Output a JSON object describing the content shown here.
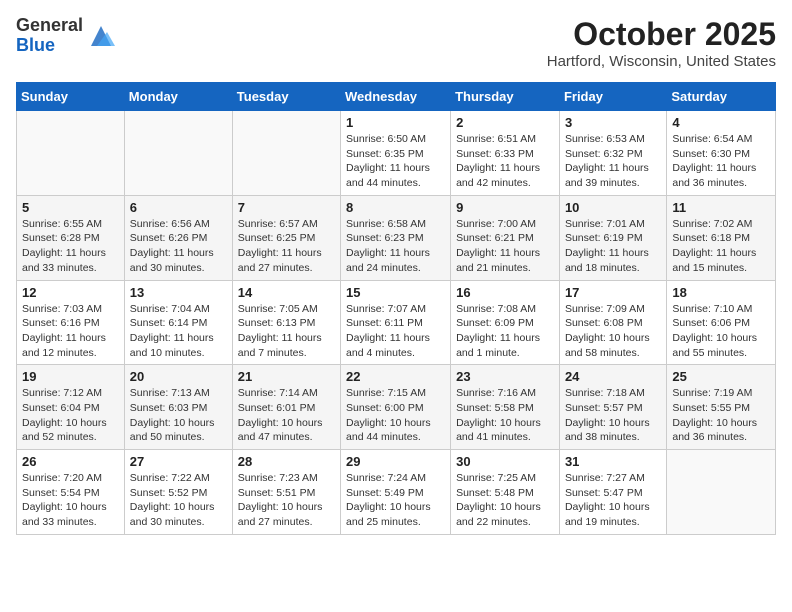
{
  "header": {
    "logo_general": "General",
    "logo_blue": "Blue",
    "month_title": "October 2025",
    "location": "Hartford, Wisconsin, United States"
  },
  "weekdays": [
    "Sunday",
    "Monday",
    "Tuesday",
    "Wednesday",
    "Thursday",
    "Friday",
    "Saturday"
  ],
  "weeks": [
    [
      {
        "day": "",
        "info": ""
      },
      {
        "day": "",
        "info": ""
      },
      {
        "day": "",
        "info": ""
      },
      {
        "day": "1",
        "info": "Sunrise: 6:50 AM\nSunset: 6:35 PM\nDaylight: 11 hours\nand 44 minutes."
      },
      {
        "day": "2",
        "info": "Sunrise: 6:51 AM\nSunset: 6:33 PM\nDaylight: 11 hours\nand 42 minutes."
      },
      {
        "day": "3",
        "info": "Sunrise: 6:53 AM\nSunset: 6:32 PM\nDaylight: 11 hours\nand 39 minutes."
      },
      {
        "day": "4",
        "info": "Sunrise: 6:54 AM\nSunset: 6:30 PM\nDaylight: 11 hours\nand 36 minutes."
      }
    ],
    [
      {
        "day": "5",
        "info": "Sunrise: 6:55 AM\nSunset: 6:28 PM\nDaylight: 11 hours\nand 33 minutes."
      },
      {
        "day": "6",
        "info": "Sunrise: 6:56 AM\nSunset: 6:26 PM\nDaylight: 11 hours\nand 30 minutes."
      },
      {
        "day": "7",
        "info": "Sunrise: 6:57 AM\nSunset: 6:25 PM\nDaylight: 11 hours\nand 27 minutes."
      },
      {
        "day": "8",
        "info": "Sunrise: 6:58 AM\nSunset: 6:23 PM\nDaylight: 11 hours\nand 24 minutes."
      },
      {
        "day": "9",
        "info": "Sunrise: 7:00 AM\nSunset: 6:21 PM\nDaylight: 11 hours\nand 21 minutes."
      },
      {
        "day": "10",
        "info": "Sunrise: 7:01 AM\nSunset: 6:19 PM\nDaylight: 11 hours\nand 18 minutes."
      },
      {
        "day": "11",
        "info": "Sunrise: 7:02 AM\nSunset: 6:18 PM\nDaylight: 11 hours\nand 15 minutes."
      }
    ],
    [
      {
        "day": "12",
        "info": "Sunrise: 7:03 AM\nSunset: 6:16 PM\nDaylight: 11 hours\nand 12 minutes."
      },
      {
        "day": "13",
        "info": "Sunrise: 7:04 AM\nSunset: 6:14 PM\nDaylight: 11 hours\nand 10 minutes."
      },
      {
        "day": "14",
        "info": "Sunrise: 7:05 AM\nSunset: 6:13 PM\nDaylight: 11 hours\nand 7 minutes."
      },
      {
        "day": "15",
        "info": "Sunrise: 7:07 AM\nSunset: 6:11 PM\nDaylight: 11 hours\nand 4 minutes."
      },
      {
        "day": "16",
        "info": "Sunrise: 7:08 AM\nSunset: 6:09 PM\nDaylight: 11 hours\nand 1 minute."
      },
      {
        "day": "17",
        "info": "Sunrise: 7:09 AM\nSunset: 6:08 PM\nDaylight: 10 hours\nand 58 minutes."
      },
      {
        "day": "18",
        "info": "Sunrise: 7:10 AM\nSunset: 6:06 PM\nDaylight: 10 hours\nand 55 minutes."
      }
    ],
    [
      {
        "day": "19",
        "info": "Sunrise: 7:12 AM\nSunset: 6:04 PM\nDaylight: 10 hours\nand 52 minutes."
      },
      {
        "day": "20",
        "info": "Sunrise: 7:13 AM\nSunset: 6:03 PM\nDaylight: 10 hours\nand 50 minutes."
      },
      {
        "day": "21",
        "info": "Sunrise: 7:14 AM\nSunset: 6:01 PM\nDaylight: 10 hours\nand 47 minutes."
      },
      {
        "day": "22",
        "info": "Sunrise: 7:15 AM\nSunset: 6:00 PM\nDaylight: 10 hours\nand 44 minutes."
      },
      {
        "day": "23",
        "info": "Sunrise: 7:16 AM\nSunset: 5:58 PM\nDaylight: 10 hours\nand 41 minutes."
      },
      {
        "day": "24",
        "info": "Sunrise: 7:18 AM\nSunset: 5:57 PM\nDaylight: 10 hours\nand 38 minutes."
      },
      {
        "day": "25",
        "info": "Sunrise: 7:19 AM\nSunset: 5:55 PM\nDaylight: 10 hours\nand 36 minutes."
      }
    ],
    [
      {
        "day": "26",
        "info": "Sunrise: 7:20 AM\nSunset: 5:54 PM\nDaylight: 10 hours\nand 33 minutes."
      },
      {
        "day": "27",
        "info": "Sunrise: 7:22 AM\nSunset: 5:52 PM\nDaylight: 10 hours\nand 30 minutes."
      },
      {
        "day": "28",
        "info": "Sunrise: 7:23 AM\nSunset: 5:51 PM\nDaylight: 10 hours\nand 27 minutes."
      },
      {
        "day": "29",
        "info": "Sunrise: 7:24 AM\nSunset: 5:49 PM\nDaylight: 10 hours\nand 25 minutes."
      },
      {
        "day": "30",
        "info": "Sunrise: 7:25 AM\nSunset: 5:48 PM\nDaylight: 10 hours\nand 22 minutes."
      },
      {
        "day": "31",
        "info": "Sunrise: 7:27 AM\nSunset: 5:47 PM\nDaylight: 10 hours\nand 19 minutes."
      },
      {
        "day": "",
        "info": ""
      }
    ]
  ]
}
